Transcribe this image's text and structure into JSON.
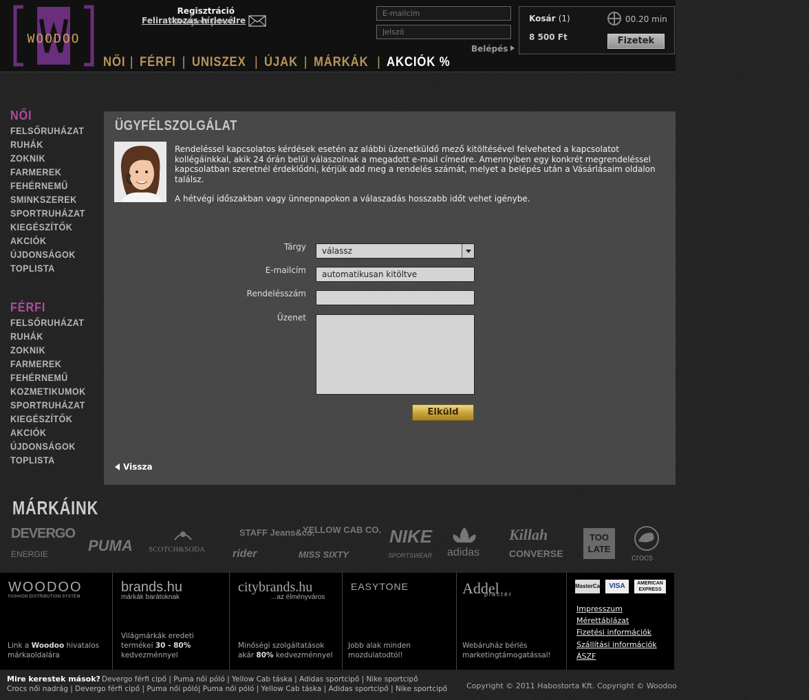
{
  "header": {
    "logo_text": "WOODOO",
    "newsletter_label": "Feliratkozás hírlevélre",
    "register_label": "Regisztráció",
    "forgot_label": "Elfelejtett jelszó",
    "email_placeholder": "E-mailcím",
    "password_placeholder": "Jelszó",
    "login_label": "Belépés",
    "cart": {
      "label": "Kosár",
      "count": "(1)",
      "price": "8 500 Ft",
      "timer": "00.20 min",
      "pay_label": "Fizetek"
    }
  },
  "nav": [
    "NŐI",
    "FÉRFI",
    "UNISZEX",
    "ÚJAK",
    "MÁRKÁK",
    "AKCIÓK %"
  ],
  "sidebar": {
    "women_title": "NŐI",
    "women_items": [
      "FELSŐRUHÁZAT",
      "RUHÁK",
      "ZOKNIK",
      "FARMEREK",
      "FEHÉRNEMŰ",
      "SMINKSZEREK",
      "SPORTRUHÁZAT",
      "KIEGÉSZÍTŐK",
      "AKCIÓK",
      "ÚJDONSÁGOK",
      "TOPLISTA"
    ],
    "men_title": "FÉRFI",
    "men_items": [
      "FELSŐRUHÁZAT",
      "RUHÁK",
      "ZOKNIK",
      "FARMEREK",
      "FEHÉRNEMŰ",
      "KOZMETIKUMOK",
      "SPORTRUHÁZAT",
      "KIEGÉSZÍTŐK",
      "AKCIÓK",
      "ÚJDONSÁGOK",
      "TOPLISTA"
    ]
  },
  "main": {
    "title": "ÜGYFÉLSZOLGÁLAT",
    "intro1": "Rendeléssel kapcsolatos kérdések esetén az alábbi üzenetküldő mező kitöltésével felveheted a kapcsolatot kollégáinkkal, akik 24 órán belül válaszolnak a megadott e-mail címedre. Amennyiben egy konkrét megrendeléssel kapcsolatban szeretnél érdeklődni, kérjük add meg a rendelés számát, melyet a belépés után a Vásárlásaim oldalon találsz.",
    "intro2": "A hétvégi időszakban vagy ünnepnapokon a válaszadás hosszabb időt vehet igénybe.",
    "form": {
      "subject_label": "Tárgy",
      "subject_value": "válassz",
      "email_label": "E-mailcím",
      "email_value": "automatikusan kitöltve",
      "order_label": "Rendelésszám",
      "order_value": "",
      "message_label": "Üzenet",
      "message_value": "",
      "submit_label": "Elküld"
    },
    "back_label": "Vissza"
  },
  "brands": {
    "title": "MÁRKÁINK",
    "items": [
      "DEVERGO",
      "ENERGIE",
      "PUMA",
      "SCOTCH&SODA",
      "STAFF Jeans&co.",
      "rider",
      "YELLOW CAB CO.",
      "MISS SIXTY",
      "NIKE",
      "SPORTSWEAR",
      "adidas",
      "Killah",
      "CONVERSE",
      "TOO LATE",
      "crocs"
    ]
  },
  "footer": {
    "cols": [
      {
        "logo": "WOODOO",
        "sub": "FASHION DISTRIBUTION SYSTEM",
        "desc_pre": "Link a ",
        "desc_bold": "Woodoo",
        "desc_post": " hivatalos márkaoldalára"
      },
      {
        "logo": "brands.hu",
        "sub": "márkák barátoknak",
        "desc_pre": "Világmárkák eredeti termékei ",
        "desc_bold": "30 - 80%",
        "desc_post": " kedvezménnyel"
      },
      {
        "logo": "citybrands.hu",
        "sub": "...az élményváros",
        "desc_pre": "Minőségi szolgáltatások akár ",
        "desc_bold": "80%",
        "desc_post": " kedvezménnyel"
      },
      {
        "logo": "EASYTONE",
        "sub": "",
        "desc_pre": "Jobb alak minden mozdulatodtól!",
        "desc_bold": "",
        "desc_post": ""
      },
      {
        "logo": "Addel",
        "sub": "piactér",
        "desc_pre": "Webáruház bérlés marketingtámogatással!",
        "desc_bold": "",
        "desc_post": ""
      }
    ],
    "cards": [
      "MasterCard",
      "VISA",
      "AMERICAN EXPRESS"
    ],
    "links": [
      "Impresszum",
      "Mérettáblázat",
      "Fizetési információk",
      "Szállítási információk",
      "ÁSZF"
    ]
  },
  "bottom": {
    "search_title": "Mire kerestek mások?",
    "line1": "Devergo férfi cipő | Puma női póló | Yellow Cab táska | Adidas sportcipő | Nike sportcipő",
    "line2": "Crocs női nadrág | Devergo férfi cipő | Puma női póló| Puma női póló | Yellow Cab táska | Adidas sportcipő | Nike sportcipő",
    "copyright": "Copyright © 2011 Habostorta Kft.   Copyright © Woodoo"
  },
  "colors": {
    "accent_gold": "#b8955a",
    "accent_purple": "#b04aa0",
    "logo_purple": "#6a2f7c"
  }
}
